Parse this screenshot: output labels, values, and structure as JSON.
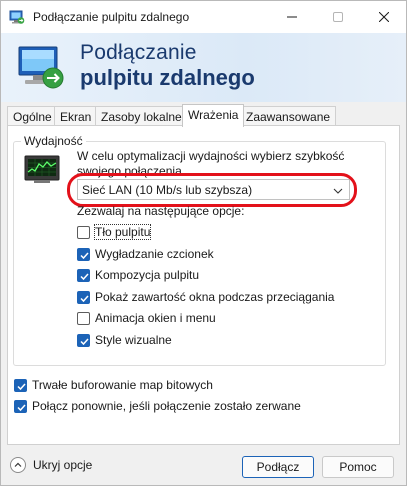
{
  "window": {
    "title": "Podłączanie pulpitu zdalnego",
    "minimize_icon": "minimize-icon",
    "maximize_icon": "maximize-icon",
    "close_icon": "close-icon"
  },
  "banner": {
    "line1": "Podłączanie",
    "line2": "pulpitu zdalnego"
  },
  "tabs": [
    {
      "label": "Ogólne",
      "active": false
    },
    {
      "label": "Ekran",
      "active": false
    },
    {
      "label": "Zasoby lokalne",
      "active": false
    },
    {
      "label": "Wrażenia",
      "active": true
    },
    {
      "label": "Zaawansowane",
      "active": false
    }
  ],
  "performance": {
    "group_label": "Wydajność",
    "description": "W celu optymalizacji wydajności wybierz szybkość swojego połączenia.",
    "connection_speed": "Sieć LAN (10 Mb/s lub szybsza)",
    "allow_label": "Zezwalaj na następujące opcje:",
    "options": [
      {
        "label": "Tło pulpitu",
        "checked": false
      },
      {
        "label": "Wygładzanie czcionek",
        "checked": true
      },
      {
        "label": "Kompozycja pulpitu",
        "checked": true
      },
      {
        "label": "Pokaż zawartość okna podczas przeciągania",
        "checked": true
      },
      {
        "label": "Animacja okien i menu",
        "checked": false
      },
      {
        "label": "Style wizualne",
        "checked": true
      }
    ]
  },
  "bottom_options": [
    {
      "label": "Trwałe buforowanie map bitowych",
      "checked": true
    },
    {
      "label": "Połącz ponownie, jeśli połączenie zostało zerwane",
      "checked": true
    }
  ],
  "footer": {
    "hide_options": "Ukryj opcje",
    "connect": "Podłącz",
    "help": "Pomoc"
  },
  "colors": {
    "accent": "#1c63b7",
    "highlight": "#e3111a",
    "banner_text": "#1a3a6e"
  }
}
